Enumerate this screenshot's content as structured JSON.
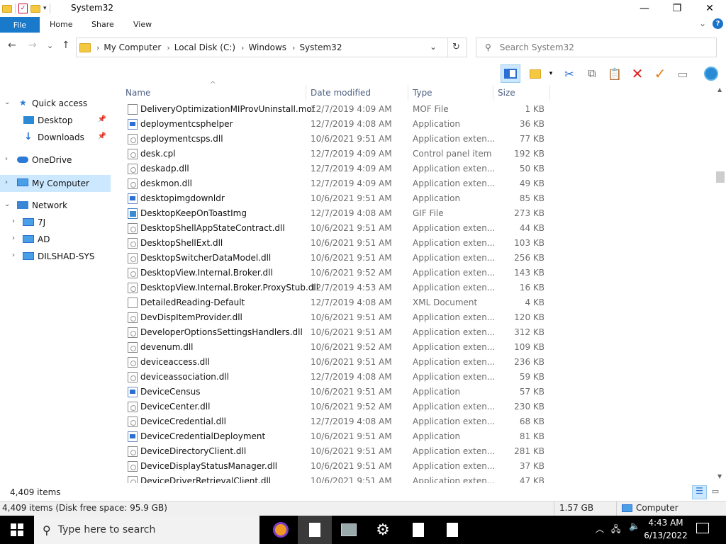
{
  "window": {
    "title": "System32",
    "minimize": "—",
    "maximize": "❐",
    "close": "✕"
  },
  "ribbon": {
    "tabs": [
      "File",
      "Home",
      "Share",
      "View"
    ],
    "collapse": "⌄",
    "help": "?"
  },
  "nav": {
    "back": "←",
    "forward": "→",
    "recent": "⌄",
    "up": "↑",
    "breadcrumb": [
      "My Computer",
      "Local Disk (C:)",
      "Windows",
      "System32"
    ],
    "dropdown": "⌄",
    "refresh": "↻",
    "search_placeholder": "Search System32"
  },
  "sidebar": {
    "items": [
      {
        "label": "Quick access",
        "icon": "star-icon"
      },
      {
        "label": "Desktop",
        "icon": "desktop-icon"
      },
      {
        "label": "Downloads",
        "icon": "download-icon"
      },
      {
        "label": "OneDrive",
        "icon": "cloud-icon"
      },
      {
        "label": "My Computer",
        "icon": "computer-icon"
      },
      {
        "label": "Network",
        "icon": "network-icon"
      },
      {
        "label": "7J",
        "icon": "computer-icon"
      },
      {
        "label": "AD",
        "icon": "computer-icon"
      },
      {
        "label": "DILSHAD-SYS",
        "icon": "computer-icon"
      }
    ]
  },
  "columns": {
    "name": "Name",
    "date": "Date modified",
    "type": "Type",
    "size": "Size"
  },
  "files": [
    {
      "name": "DeliveryOptimizationMIProvUninstall.mof",
      "date": "12/7/2019 4:09 AM",
      "type": "MOF File",
      "size": "1 KB",
      "kind": "file"
    },
    {
      "name": "deploymentcsphelper",
      "date": "12/7/2019 4:08 AM",
      "type": "Application",
      "size": "36 KB",
      "kind": "app"
    },
    {
      "name": "deploymentcsps.dll",
      "date": "10/6/2021 9:51 AM",
      "type": "Application exten...",
      "size": "77 KB",
      "kind": "dll"
    },
    {
      "name": "desk.cpl",
      "date": "12/7/2019 4:09 AM",
      "type": "Control panel item",
      "size": "192 KB",
      "kind": "dll"
    },
    {
      "name": "deskadp.dll",
      "date": "12/7/2019 4:09 AM",
      "type": "Application exten...",
      "size": "50 KB",
      "kind": "dll"
    },
    {
      "name": "deskmon.dll",
      "date": "12/7/2019 4:09 AM",
      "type": "Application exten...",
      "size": "49 KB",
      "kind": "dll"
    },
    {
      "name": "desktopimgdownldr",
      "date": "10/6/2021 9:51 AM",
      "type": "Application",
      "size": "85 KB",
      "kind": "app"
    },
    {
      "name": "DesktopKeepOnToastImg",
      "date": "12/7/2019 4:08 AM",
      "type": "GIF File",
      "size": "273 KB",
      "kind": "gif"
    },
    {
      "name": "DesktopShellAppStateContract.dll",
      "date": "10/6/2021 9:51 AM",
      "type": "Application exten...",
      "size": "44 KB",
      "kind": "dll"
    },
    {
      "name": "DesktopShellExt.dll",
      "date": "10/6/2021 9:51 AM",
      "type": "Application exten...",
      "size": "103 KB",
      "kind": "dll"
    },
    {
      "name": "DesktopSwitcherDataModel.dll",
      "date": "10/6/2021 9:51 AM",
      "type": "Application exten...",
      "size": "256 KB",
      "kind": "dll"
    },
    {
      "name": "DesktopView.Internal.Broker.dll",
      "date": "10/6/2021 9:52 AM",
      "type": "Application exten...",
      "size": "143 KB",
      "kind": "dll"
    },
    {
      "name": "DesktopView.Internal.Broker.ProxyStub.dll",
      "date": "12/7/2019 4:53 AM",
      "type": "Application exten...",
      "size": "16 KB",
      "kind": "dll"
    },
    {
      "name": "DetailedReading-Default",
      "date": "12/7/2019 4:08 AM",
      "type": "XML Document",
      "size": "4 KB",
      "kind": "file"
    },
    {
      "name": "DevDispItemProvider.dll",
      "date": "10/6/2021 9:51 AM",
      "type": "Application exten...",
      "size": "120 KB",
      "kind": "dll"
    },
    {
      "name": "DeveloperOptionsSettingsHandlers.dll",
      "date": "10/6/2021 9:51 AM",
      "type": "Application exten...",
      "size": "312 KB",
      "kind": "dll"
    },
    {
      "name": "devenum.dll",
      "date": "10/6/2021 9:52 AM",
      "type": "Application exten...",
      "size": "109 KB",
      "kind": "dll"
    },
    {
      "name": "deviceaccess.dll",
      "date": "10/6/2021 9:51 AM",
      "type": "Application exten...",
      "size": "236 KB",
      "kind": "dll"
    },
    {
      "name": "deviceassociation.dll",
      "date": "12/7/2019 4:08 AM",
      "type": "Application exten...",
      "size": "59 KB",
      "kind": "dll"
    },
    {
      "name": "DeviceCensus",
      "date": "10/6/2021 9:51 AM",
      "type": "Application",
      "size": "57 KB",
      "kind": "app"
    },
    {
      "name": "DeviceCenter.dll",
      "date": "10/6/2021 9:52 AM",
      "type": "Application exten...",
      "size": "230 KB",
      "kind": "dll"
    },
    {
      "name": "DeviceCredential.dll",
      "date": "12/7/2019 4:08 AM",
      "type": "Application exten...",
      "size": "68 KB",
      "kind": "dll"
    },
    {
      "name": "DeviceCredentialDeployment",
      "date": "10/6/2021 9:51 AM",
      "type": "Application",
      "size": "81 KB",
      "kind": "app"
    },
    {
      "name": "DeviceDirectoryClient.dll",
      "date": "10/6/2021 9:51 AM",
      "type": "Application exten...",
      "size": "281 KB",
      "kind": "dll"
    },
    {
      "name": "DeviceDisplayStatusManager.dll",
      "date": "10/6/2021 9:51 AM",
      "type": "Application exten...",
      "size": "37 KB",
      "kind": "dll"
    },
    {
      "name": "DeviceDriverRetrievalClient.dll",
      "date": "10/6/2021 9:51 AM",
      "type": "Application exten...",
      "size": "47 KB",
      "kind": "dll"
    }
  ],
  "status": {
    "item_count": "4,409 items",
    "details": "4,409 items (Disk free space: 95.9 GB)",
    "size": "1.57 GB",
    "location": "Computer"
  },
  "taskbar": {
    "search_placeholder": "Type here to search",
    "time": "4:43 AM",
    "date": "6/13/2022"
  },
  "colors": {
    "accent": "#1979ca",
    "selection": "#cce8ff",
    "taskbar": "#000000"
  }
}
